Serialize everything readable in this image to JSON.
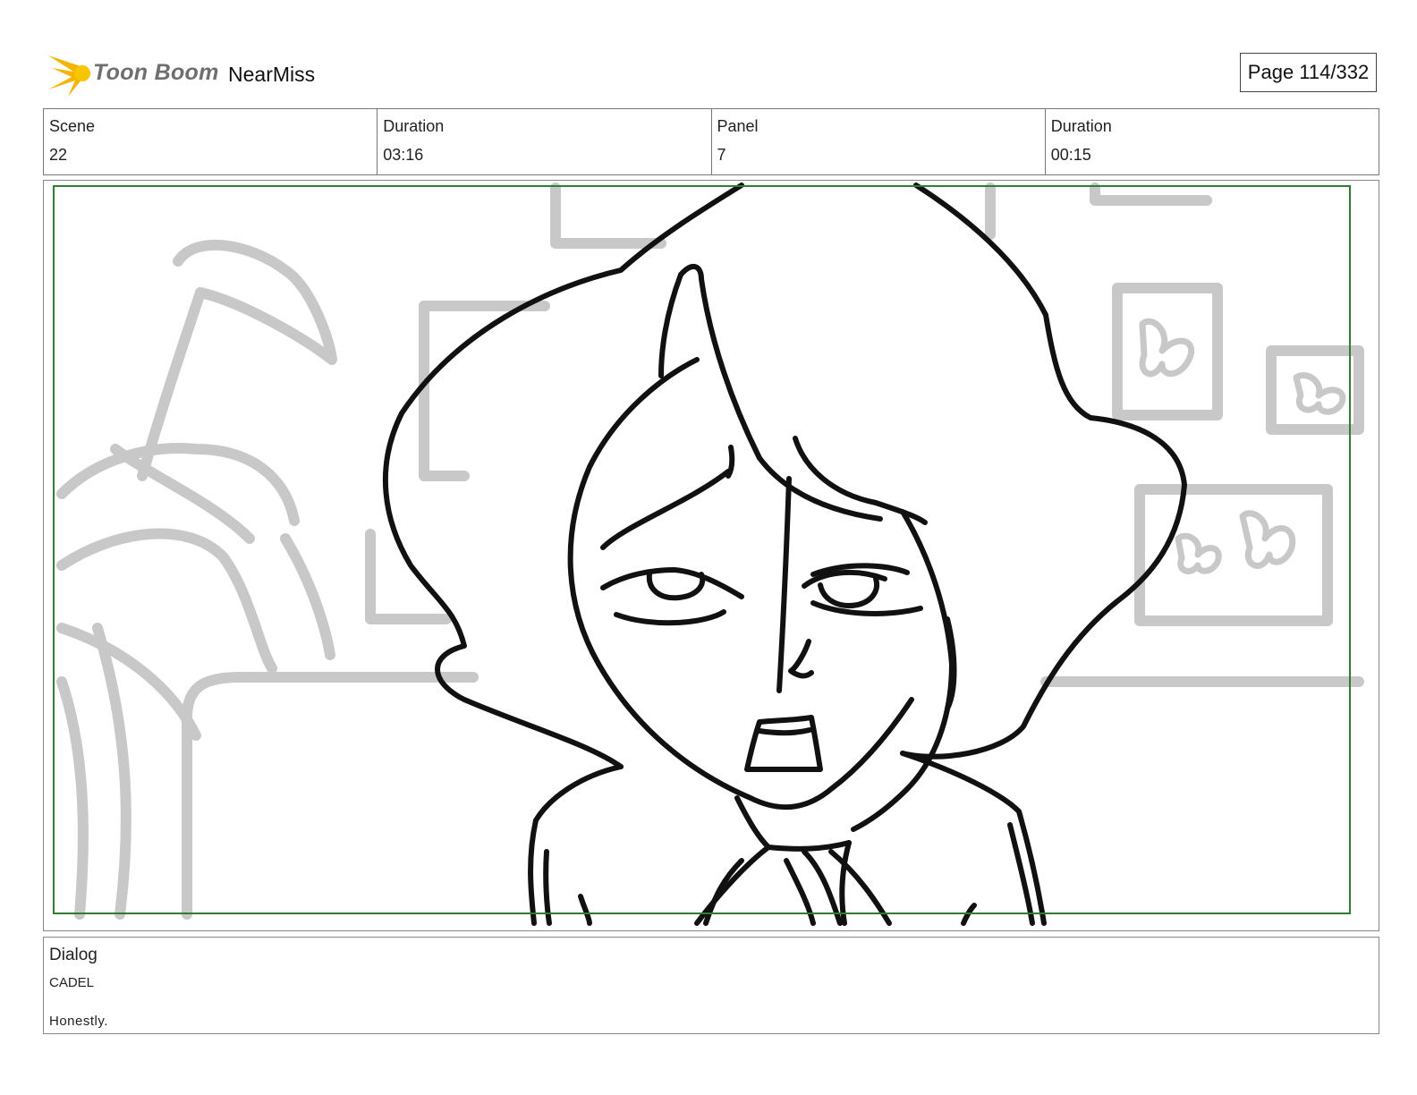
{
  "header": {
    "logo_text": "Toon Boom",
    "project_title": "NearMiss",
    "page_indicator": "Page 114/332"
  },
  "info": {
    "scene_label": "Scene",
    "scene_value": "22",
    "scene_duration_label": "Duration",
    "scene_duration_value": "03:16",
    "panel_label": "Panel",
    "panel_value": "7",
    "panel_duration_label": "Duration",
    "panel_duration_value": "00:15"
  },
  "dialog": {
    "label": "Dialog",
    "character": "CADEL",
    "line": "Honestly."
  },
  "colors": {
    "safe_frame": "#2e7d32",
    "background_sketch": "#c8c8c8",
    "ink": "#111111",
    "logo_star": "#f5b400"
  }
}
